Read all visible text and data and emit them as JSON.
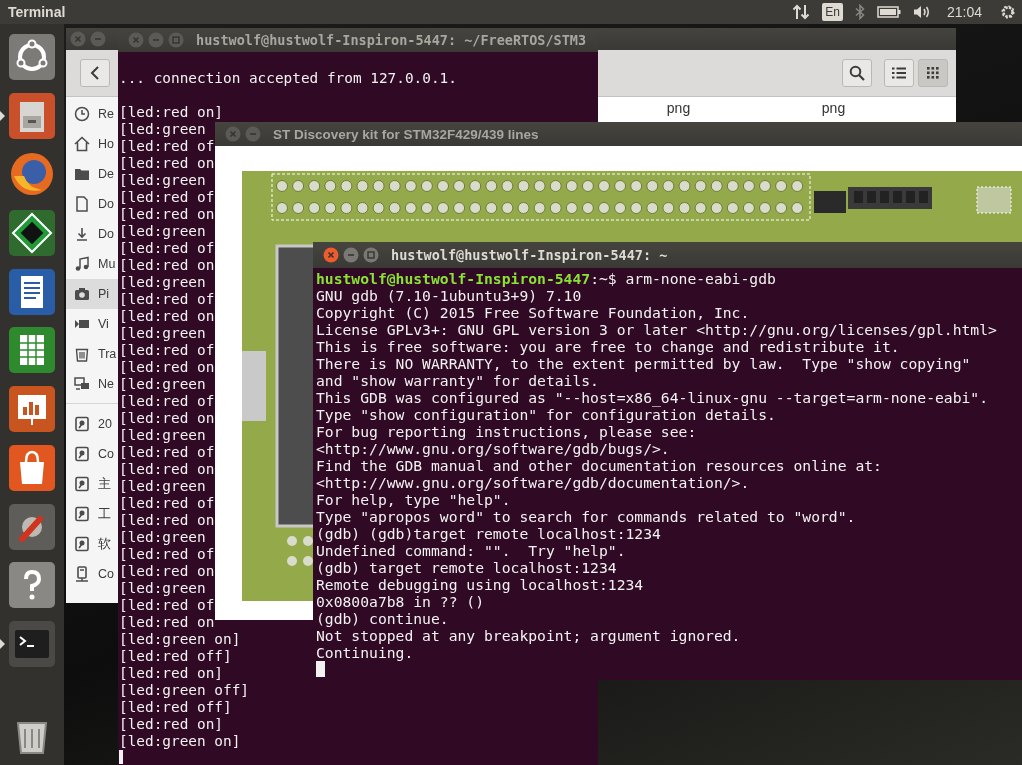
{
  "top_panel": {
    "app_title": "Terminal",
    "keyboard_layout": "En",
    "clock": "21:04"
  },
  "launcher": {
    "items": [
      {
        "kind": "dash",
        "running": false
      },
      {
        "kind": "files",
        "running": true
      },
      {
        "kind": "browser",
        "running": false
      },
      {
        "kind": "vim",
        "running": false
      },
      {
        "kind": "writer",
        "running": false
      },
      {
        "kind": "calc",
        "running": false
      },
      {
        "kind": "impress",
        "running": false
      },
      {
        "kind": "software",
        "running": false
      },
      {
        "kind": "settings",
        "running": false
      },
      {
        "kind": "help",
        "running": false
      },
      {
        "kind": "terminal",
        "running": true
      },
      {
        "kind": "trash",
        "running": false
      }
    ]
  },
  "file_manager": {
    "active": false,
    "buttons": [
      {
        "kind": "close"
      },
      {
        "kind": "minimize"
      }
    ],
    "view_buttons": [
      {
        "kind": "list",
        "selected": false
      },
      {
        "kind": "grid",
        "selected": true
      }
    ],
    "sidebar": {
      "places": [
        {
          "kind": "recent",
          "label": "Re",
          "selected": false
        },
        {
          "kind": "home",
          "label": "Ho",
          "selected": false
        },
        {
          "kind": "folder",
          "label": "De",
          "selected": false
        },
        {
          "kind": "document",
          "label": "Do",
          "selected": false
        },
        {
          "kind": "download",
          "label": "Do",
          "selected": false
        },
        {
          "kind": "music",
          "label": "Mu",
          "selected": false
        },
        {
          "kind": "camera",
          "label": "Pi",
          "selected": true
        },
        {
          "kind": "video",
          "label": "Vi",
          "selected": false
        },
        {
          "kind": "trash",
          "label": "Tra",
          "selected": false
        },
        {
          "kind": "network",
          "label": "Ne",
          "selected": false
        }
      ],
      "devices": [
        {
          "kind": "drive",
          "label": "20",
          "selected": false
        },
        {
          "kind": "drive",
          "label": "Co",
          "selected": false
        },
        {
          "kind": "drive",
          "label": "主",
          "selected": false
        },
        {
          "kind": "drive",
          "label": "工",
          "selected": false
        },
        {
          "kind": "drive",
          "label": "软",
          "selected": false
        },
        {
          "kind": "computer",
          "label": "Co",
          "selected": false
        }
      ]
    },
    "files": [
      {
        "label": "png"
      },
      {
        "label": "png"
      }
    ]
  },
  "log_terminal": {
    "title": "hustwolf@hustwolf-Inspiron-5447: ~/FreeRTOS/STM3",
    "active": false,
    "buttons": [
      {
        "kind": "close"
      },
      {
        "kind": "minimize"
      },
      {
        "kind": "maximize"
      }
    ],
    "message": "... connection accepted from 127.0.0.1.",
    "lines": [
      "[led:red on]",
      "[led:green",
      "[led:red of",
      "[led:red on",
      "[led:green",
      "[led:red of",
      "[led:red on",
      "[led:green",
      "[led:red of",
      "[led:red on",
      "[led:green",
      "[led:red of",
      "[led:red on",
      "[led:green",
      "[led:red of",
      "[led:red on",
      "[led:green",
      "[led:red of",
      "[led:red on",
      "[led:green",
      "[led:red of",
      "[led:red on",
      "[led:green",
      "[led:red of",
      "[led:red on",
      "[led:green",
      "[led:red of",
      "[led:red on",
      "[led:green",
      "[led:red of",
      "[led:red on",
      "[led:green on]",
      "[led:red off]",
      "[led:red on]",
      "[led:green off]",
      "[led:red off]",
      "[led:red on]",
      "[led:green on]"
    ]
  },
  "board_window": {
    "title": "ST Discovery kit for STM32F429/439 lines",
    "active": false,
    "buttons": [
      {
        "kind": "close"
      },
      {
        "kind": "minimize"
      }
    ]
  },
  "gdb_terminal": {
    "title": "hustwolf@hustwolf-Inspiron-5447: ~",
    "active": true,
    "buttons": [
      {
        "kind": "close"
      },
      {
        "kind": "minimize"
      },
      {
        "kind": "maximize"
      }
    ],
    "lines": [
      {
        "kind": "prompt",
        "prompt": "hustwolf@hustwolf-Inspiron-5447",
        "text": ":~$ arm-none-eabi-gdb"
      },
      {
        "kind": "output",
        "text": "GNU gdb (7.10-1ubuntu3+9) 7.10"
      },
      {
        "kind": "output",
        "text": "Copyright (C) 2015 Free Software Foundation, Inc."
      },
      {
        "kind": "output",
        "text": "License GPLv3+: GNU GPL version 3 or later <http://gnu.org/licenses/gpl.html>"
      },
      {
        "kind": "output",
        "text": "This is free software: you are free to change and redistribute it."
      },
      {
        "kind": "output",
        "text": "There is NO WARRANTY, to the extent permitted by law.  Type \"show copying\""
      },
      {
        "kind": "output",
        "text": "and \"show warranty\" for details."
      },
      {
        "kind": "output",
        "text": "This GDB was configured as \"--host=x86_64-linux-gnu --target=arm-none-eabi\"."
      },
      {
        "kind": "output",
        "text": "Type \"show configuration\" for configuration details."
      },
      {
        "kind": "output",
        "text": "For bug reporting instructions, please see:"
      },
      {
        "kind": "output",
        "text": "<http://www.gnu.org/software/gdb/bugs/>."
      },
      {
        "kind": "output",
        "text": "Find the GDB manual and other documentation resources online at:"
      },
      {
        "kind": "output",
        "text": "<http://www.gnu.org/software/gdb/documentation/>."
      },
      {
        "kind": "output",
        "text": "For help, type \"help\"."
      },
      {
        "kind": "output",
        "text": "Type \"apropos word\" to search for commands related to \"word\"."
      },
      {
        "kind": "output",
        "text": "(gdb) (gdb)target remote localhost:1234"
      },
      {
        "kind": "output",
        "text": "Undefined command: \"\".  Try \"help\"."
      },
      {
        "kind": "output",
        "text": "(gdb) target remote localhost:1234"
      },
      {
        "kind": "output",
        "text": "Remote debugging using localhost:1234"
      },
      {
        "kind": "output",
        "text": "0x0800a7b8 in ?? ()"
      },
      {
        "kind": "output",
        "text": "(gdb) continue."
      },
      {
        "kind": "output",
        "text": "Not stopped at any breakpoint; argument ignored."
      },
      {
        "kind": "output",
        "text": "Continuing."
      }
    ]
  }
}
